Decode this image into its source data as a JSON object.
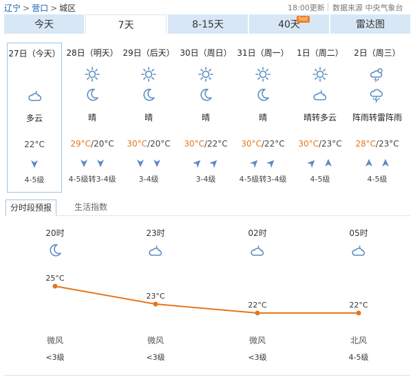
{
  "breadcrumb": {
    "items": [
      "辽宁",
      "营口",
      "城区"
    ],
    "sep": ">"
  },
  "updated": "18:00更新",
  "source": "数据来源 中央气象台",
  "tabs": [
    {
      "label": "今天",
      "active": false
    },
    {
      "label": "7天",
      "active": true
    },
    {
      "label": "8-15天",
      "active": false
    },
    {
      "label": "40天",
      "active": false,
      "badge": "hot"
    },
    {
      "label": "雷达图",
      "active": false
    }
  ],
  "colors": {
    "accent": "#e4761b",
    "icon": "#5a8cc0",
    "tab_bg": "#d7e7f5",
    "today_border": "#9cc4e4"
  },
  "days": [
    {
      "date": "27日（今天）",
      "icons": [],
      "night_icon": "partly-cloudy-night-icon",
      "weather": "多云",
      "high": "",
      "low": "22°C",
      "wind_arrows": [
        "south-wind-icon"
      ],
      "level": "4-5级",
      "today": true
    },
    {
      "date": "28日（明天）",
      "icons": [
        "sun-icon",
        "moon-icon"
      ],
      "weather": "晴",
      "high": "29°C",
      "low": "20°C",
      "wind_arrows": [
        "south-wind-icon",
        "south-wind-icon"
      ],
      "level": "4-5级转3-4级"
    },
    {
      "date": "29日（后天）",
      "icons": [
        "sun-icon",
        "moon-icon"
      ],
      "weather": "晴",
      "high": "30°C",
      "low": "20°C",
      "wind_arrows": [
        "south-wind-icon",
        "south-wind-icon"
      ],
      "level": "3-4级"
    },
    {
      "date": "30日（周日）",
      "icons": [
        "sun-icon",
        "moon-icon"
      ],
      "weather": "晴",
      "high": "30°C",
      "low": "22°C",
      "wind_arrows": [
        "northeast-wind-icon",
        "northeast-wind-icon"
      ],
      "level": "3-4级"
    },
    {
      "date": "31日（周一）",
      "icons": [
        "sun-icon",
        "moon-icon"
      ],
      "weather": "晴",
      "high": "30°C",
      "low": "22°C",
      "wind_arrows": [
        "northeast-wind-icon",
        "northeast-wind-icon"
      ],
      "level": "4-5级转3-4级"
    },
    {
      "date": "1日（周二）",
      "icons": [
        "sun-icon",
        "partly-cloudy-night-icon"
      ],
      "weather": "晴转多云",
      "high": "30°C",
      "low": "23°C",
      "wind_arrows": [
        "northeast-wind-icon",
        "north-wind-icon"
      ],
      "level": "4-5级"
    },
    {
      "date": "2日（周三）",
      "icons": [
        "thunder-shower-day-icon",
        "thunder-shower-icon"
      ],
      "weather": "阵雨转雷阵雨",
      "high": "28°C",
      "low": "23°C",
      "wind_arrows": [
        "north-wind-icon",
        "north-wind-icon"
      ],
      "level": "4-5级"
    }
  ],
  "subtabs": {
    "active": "分时段预报",
    "other": "生活指数"
  },
  "hourly": {
    "points": [
      {
        "time": "20时",
        "icon": "moon-icon",
        "temp": "25°C",
        "value": 25,
        "wind": "微风",
        "level": "<3级"
      },
      {
        "time": "23时",
        "icon": "partly-cloudy-night-icon",
        "temp": "23°C",
        "value": 23,
        "wind": "微风",
        "level": "<3级"
      },
      {
        "time": "02时",
        "icon": "partly-cloudy-night-icon",
        "temp": "22°C",
        "value": 22,
        "wind": "微风",
        "level": "<3级"
      },
      {
        "time": "05时",
        "icon": "partly-cloudy-night-icon",
        "temp": "22°C",
        "value": 22,
        "wind": "北风",
        "level": "4-5级"
      }
    ]
  }
}
